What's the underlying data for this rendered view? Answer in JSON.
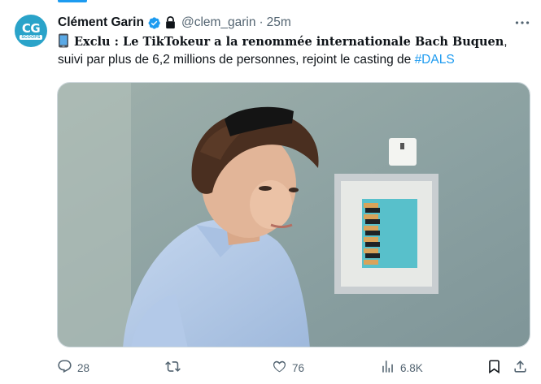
{
  "author": {
    "avatar_text": "CG",
    "avatar_subtext": "SCOOPS",
    "name": "Clément Garin",
    "handle": "@clem_garin",
    "separator": "·",
    "time": "25m"
  },
  "tweet": {
    "bold_text": "Exclu : Le TikTokeur a la renommée internationale Bach Buquen",
    "text_after": ", suivi par plus de 6,2 millions de personnes, rejoint le casting de ",
    "hashtag": "#DALS"
  },
  "actions": {
    "reply_count": "28",
    "repost_count": "",
    "like_count": "76",
    "views_count": "6.8K"
  },
  "icons": [
    "verified-icon",
    "lock-icon",
    "more-icon",
    "phone-icon",
    "reply-icon",
    "repost-icon",
    "like-icon",
    "views-icon",
    "bookmark-icon",
    "share-icon"
  ],
  "colors": {
    "accent": "#1d9bf0",
    "secondary_text": "#536471",
    "avatar_bg": "#2aa3c9"
  }
}
